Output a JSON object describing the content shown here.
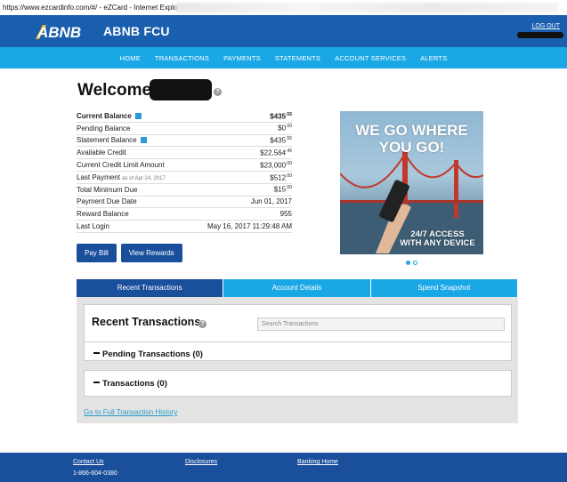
{
  "window": {
    "title": "https://www.ezcardinfo.com/#/ - eZCard - Internet Explorer"
  },
  "header": {
    "logo_text": "ABNB",
    "brand": "ABNB FCU",
    "logout": "LOG OUT"
  },
  "nav": {
    "items": [
      "HOME",
      "TRANSACTIONS",
      "PAYMENTS",
      "STATEMENTS",
      "ACCOUNT SERVICES",
      "ALERTS"
    ]
  },
  "welcome": {
    "text": "Welcome,",
    "help": "?"
  },
  "account": {
    "rows": [
      {
        "label": "Current Balance",
        "value": "$435",
        "cents": ".55"
      },
      {
        "label": "Pending Balance",
        "value": "$0",
        "cents": ".00"
      },
      {
        "label": "Statement Balance",
        "value": "$435",
        "cents": ".55"
      },
      {
        "label": "Available Credit",
        "value": "$22,564",
        "cents": ".45"
      },
      {
        "label": "Current Credit Limit Amount",
        "value": "$23,000",
        "cents": ".00"
      },
      {
        "label": "Last Payment",
        "sub": "as of Apr 24, 2017",
        "value": "$512",
        "cents": ".00"
      },
      {
        "label": "Total Minimum Due",
        "value": "$15",
        "cents": ".00"
      },
      {
        "label": "Payment Due Date",
        "value": "Jun 01, 2017",
        "cents": ""
      },
      {
        "label": "Reward Balance",
        "value": "955",
        "cents": ""
      },
      {
        "label": "Last Login",
        "value": "May 16, 2017 11:29:48 AM",
        "cents": ""
      }
    ]
  },
  "buttons": {
    "pay_bill": "Pay Bill",
    "view_rewards": "View Rewards"
  },
  "promo": {
    "headline_1": "WE GO WHERE",
    "headline_2": "YOU GO!",
    "sub_1": "24/7 ACCESS",
    "sub_2": "WITH ANY DEVICE",
    "slide_index": 1,
    "slide_count": 2
  },
  "tabs": [
    "Recent Transactions",
    "Account Details",
    "Spend Snapshot"
  ],
  "transactions": {
    "title": "Recent Transactions",
    "help": "?",
    "search_placeholder": "Search Transactions",
    "pending": "Pending Transactions (0)",
    "posted": "Transactions (0)",
    "full_history_link": "Go to Full Transaction History"
  },
  "footer": {
    "contact": "Contact Us",
    "disclosures": "Disclosures",
    "banking_home": "Banking Home",
    "phone": "1-866-604-0380"
  },
  "colors": {
    "primary": "#1a5fae",
    "nav": "#1aa7e6",
    "dark_button": "#1a4f9c"
  }
}
